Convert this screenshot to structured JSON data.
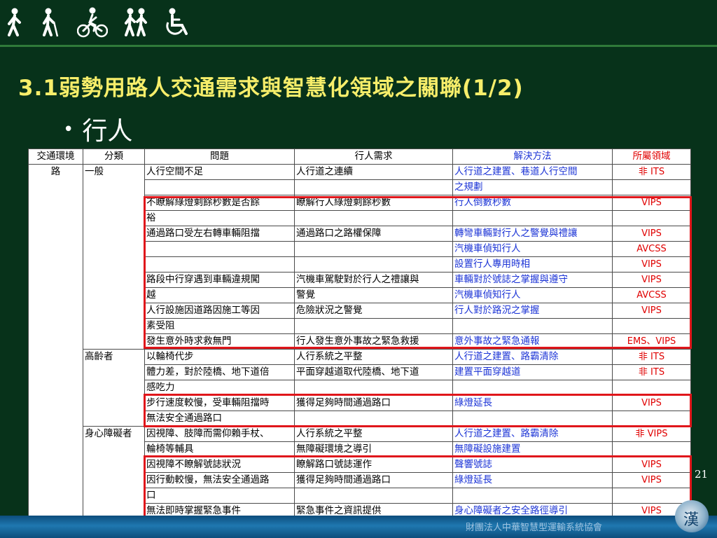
{
  "icons": [
    "walking-person-icon",
    "walking-with-cane-icon",
    "cyclist-icon",
    "pedestrian-pair-icon",
    "wheelchair-icon"
  ],
  "title": "3.1弱勢用路人交通需求與智慧化領域之關聯(1/2)",
  "bullet": "行人",
  "page_number": "21",
  "logo_char": "漢",
  "footer_text": "財團法人中華智慧型運輸系統協會",
  "colors": {
    "background": "#07321a",
    "title": "#f7ee6a",
    "solution": "#1c34d6",
    "domain": "#e00000",
    "highlight_box": "#e0161b",
    "band": "#1f78b0"
  },
  "table": {
    "headers": [
      "交通環境",
      "分類",
      "問題",
      "行人需求",
      "解決方法",
      "所屬領域"
    ],
    "env": "路",
    "categories": [
      "一般",
      "高齡者",
      "身心障礙者"
    ],
    "rows": [
      {
        "p": "人行空間不足",
        "n": "人行道之連續",
        "s": "人行道之建置、巷道人行空間",
        "d": "非 ITS"
      },
      {
        "p": "",
        "n": "",
        "s": "之規劃",
        "d": ""
      },
      {
        "p": "不瞭解綠燈剩餘秒數是否餘",
        "n": "瞭解行人綠燈剩餘秒數",
        "s": "行人倒數秒數",
        "d": "VIPS"
      },
      {
        "p": "裕",
        "n": "",
        "s": "",
        "d": ""
      },
      {
        "p": "通過路口受左右轉車輛阻擋",
        "n": "通過路口之路權保障",
        "s": "轉彎車輛對行人之警覺與禮讓",
        "d": "VIPS"
      },
      {
        "p": "",
        "n": "",
        "s": "汽機車偵知行人",
        "d": "AVCSS"
      },
      {
        "p": "",
        "n": "",
        "s": "設置行人專用時相",
        "d": "VIPS"
      },
      {
        "p": "路段中行穿遇到車輛違規闖",
        "n": "汽機車駕駛對於行人之禮讓與",
        "s": "車輛對於號誌之掌握與遵守",
        "d": "VIPS"
      },
      {
        "p": "越",
        "n": "警覺",
        "s": "汽機車偵知行人",
        "d": "AVCSS"
      },
      {
        "p": "人行設施因道路因施工等因",
        "n": "危險狀況之警覺",
        "s": "行人對於路況之掌握",
        "d": "VIPS"
      },
      {
        "p": "素受阻",
        "n": "",
        "s": "",
        "d": ""
      },
      {
        "p": "發生意外時求救無門",
        "n": "行人發生意外事故之緊急救援",
        "s": "意外事故之緊急通報",
        "d": "EMS、VIPS"
      },
      {
        "p": "以輪椅代步",
        "n": "人行系統之平整",
        "s": "人行道之建置、路霸清除",
        "d": "非 ITS"
      },
      {
        "p": "體力差，對於陸橋、地下道倍",
        "n": "平面穿越道取代陸橋、地下道",
        "s": "建置平面穿越道",
        "d": "非 ITS"
      },
      {
        "p": "感吃力",
        "n": "",
        "s": "",
        "d": ""
      },
      {
        "p": "步行速度較慢，受車輛阻擋時",
        "n": "獲得足夠時間通過路口",
        "s": "綠燈延長",
        "d": "VIPS"
      },
      {
        "p": "無法安全通過路口",
        "n": "",
        "s": "",
        "d": ""
      },
      {
        "p": "因視障、肢障而需仰賴手杖、",
        "n": "人行系統之平整",
        "s": "人行道之建置、路霸清除",
        "d": "非 VIPS"
      },
      {
        "p": "輪椅等輔具",
        "n": "無障礙環境之導引",
        "s": "無障礙設施建置",
        "d": ""
      },
      {
        "p": "因視障不瞭解號誌狀況",
        "n": "瞭解路口號誌運作",
        "s": "聲響號誌",
        "d": "VIPS"
      },
      {
        "p": "因行動較慢，無法安全通過路",
        "n": "獲得足夠時間通過路口",
        "s": "綠燈延長",
        "d": "VIPS"
      },
      {
        "p": "口",
        "n": "",
        "s": "",
        "d": ""
      },
      {
        "p": "無法即時掌握緊急事件",
        "n": "緊急事件之資訊提供",
        "s": "身心障礙者之安全路徑導引",
        "d": "VIPS"
      }
    ]
  }
}
